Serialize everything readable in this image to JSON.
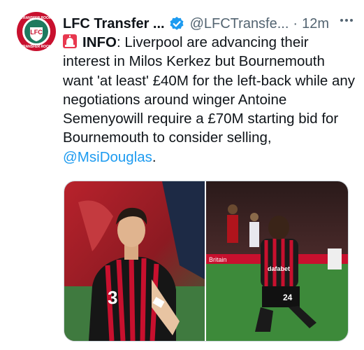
{
  "tweet": {
    "display_name": "LFC Transfer ...",
    "handle": "@LFCTransfe...",
    "separator": "·",
    "timestamp": "12m",
    "more_icon": "ellipsis-icon",
    "verified_icon": "verified-badge-icon",
    "info_icon": "siren-icon",
    "info_label": "INFO",
    "body_text": ": Liverpool are advancing their interest in Milos Kerkez but Bournemouth want 'at least' £40M for the left-back while any negotiations around winger Antoine Semenyowill require a £70M starting bid for Bournemouth to consider selling,",
    "mention": "@MsiDouglas",
    "trailing": "."
  },
  "avatar": {
    "logo_text_top": "TRANSFER ROOM",
    "logo_text_bottom": "TRANSFER ROOM",
    "colors": {
      "ring": "#c8102e",
      "inner": "#1e7a5f"
    }
  },
  "media": {
    "left_image": {
      "shirt_number": "3"
    },
    "right_image": {
      "shirt_number": "24",
      "sponsor": "dafabet",
      "board_text": "Britain"
    }
  },
  "colors": {
    "text": "#0f1419",
    "secondary": "#536471",
    "link": "#1d9bf0",
    "verified": "#1d9bf0"
  }
}
